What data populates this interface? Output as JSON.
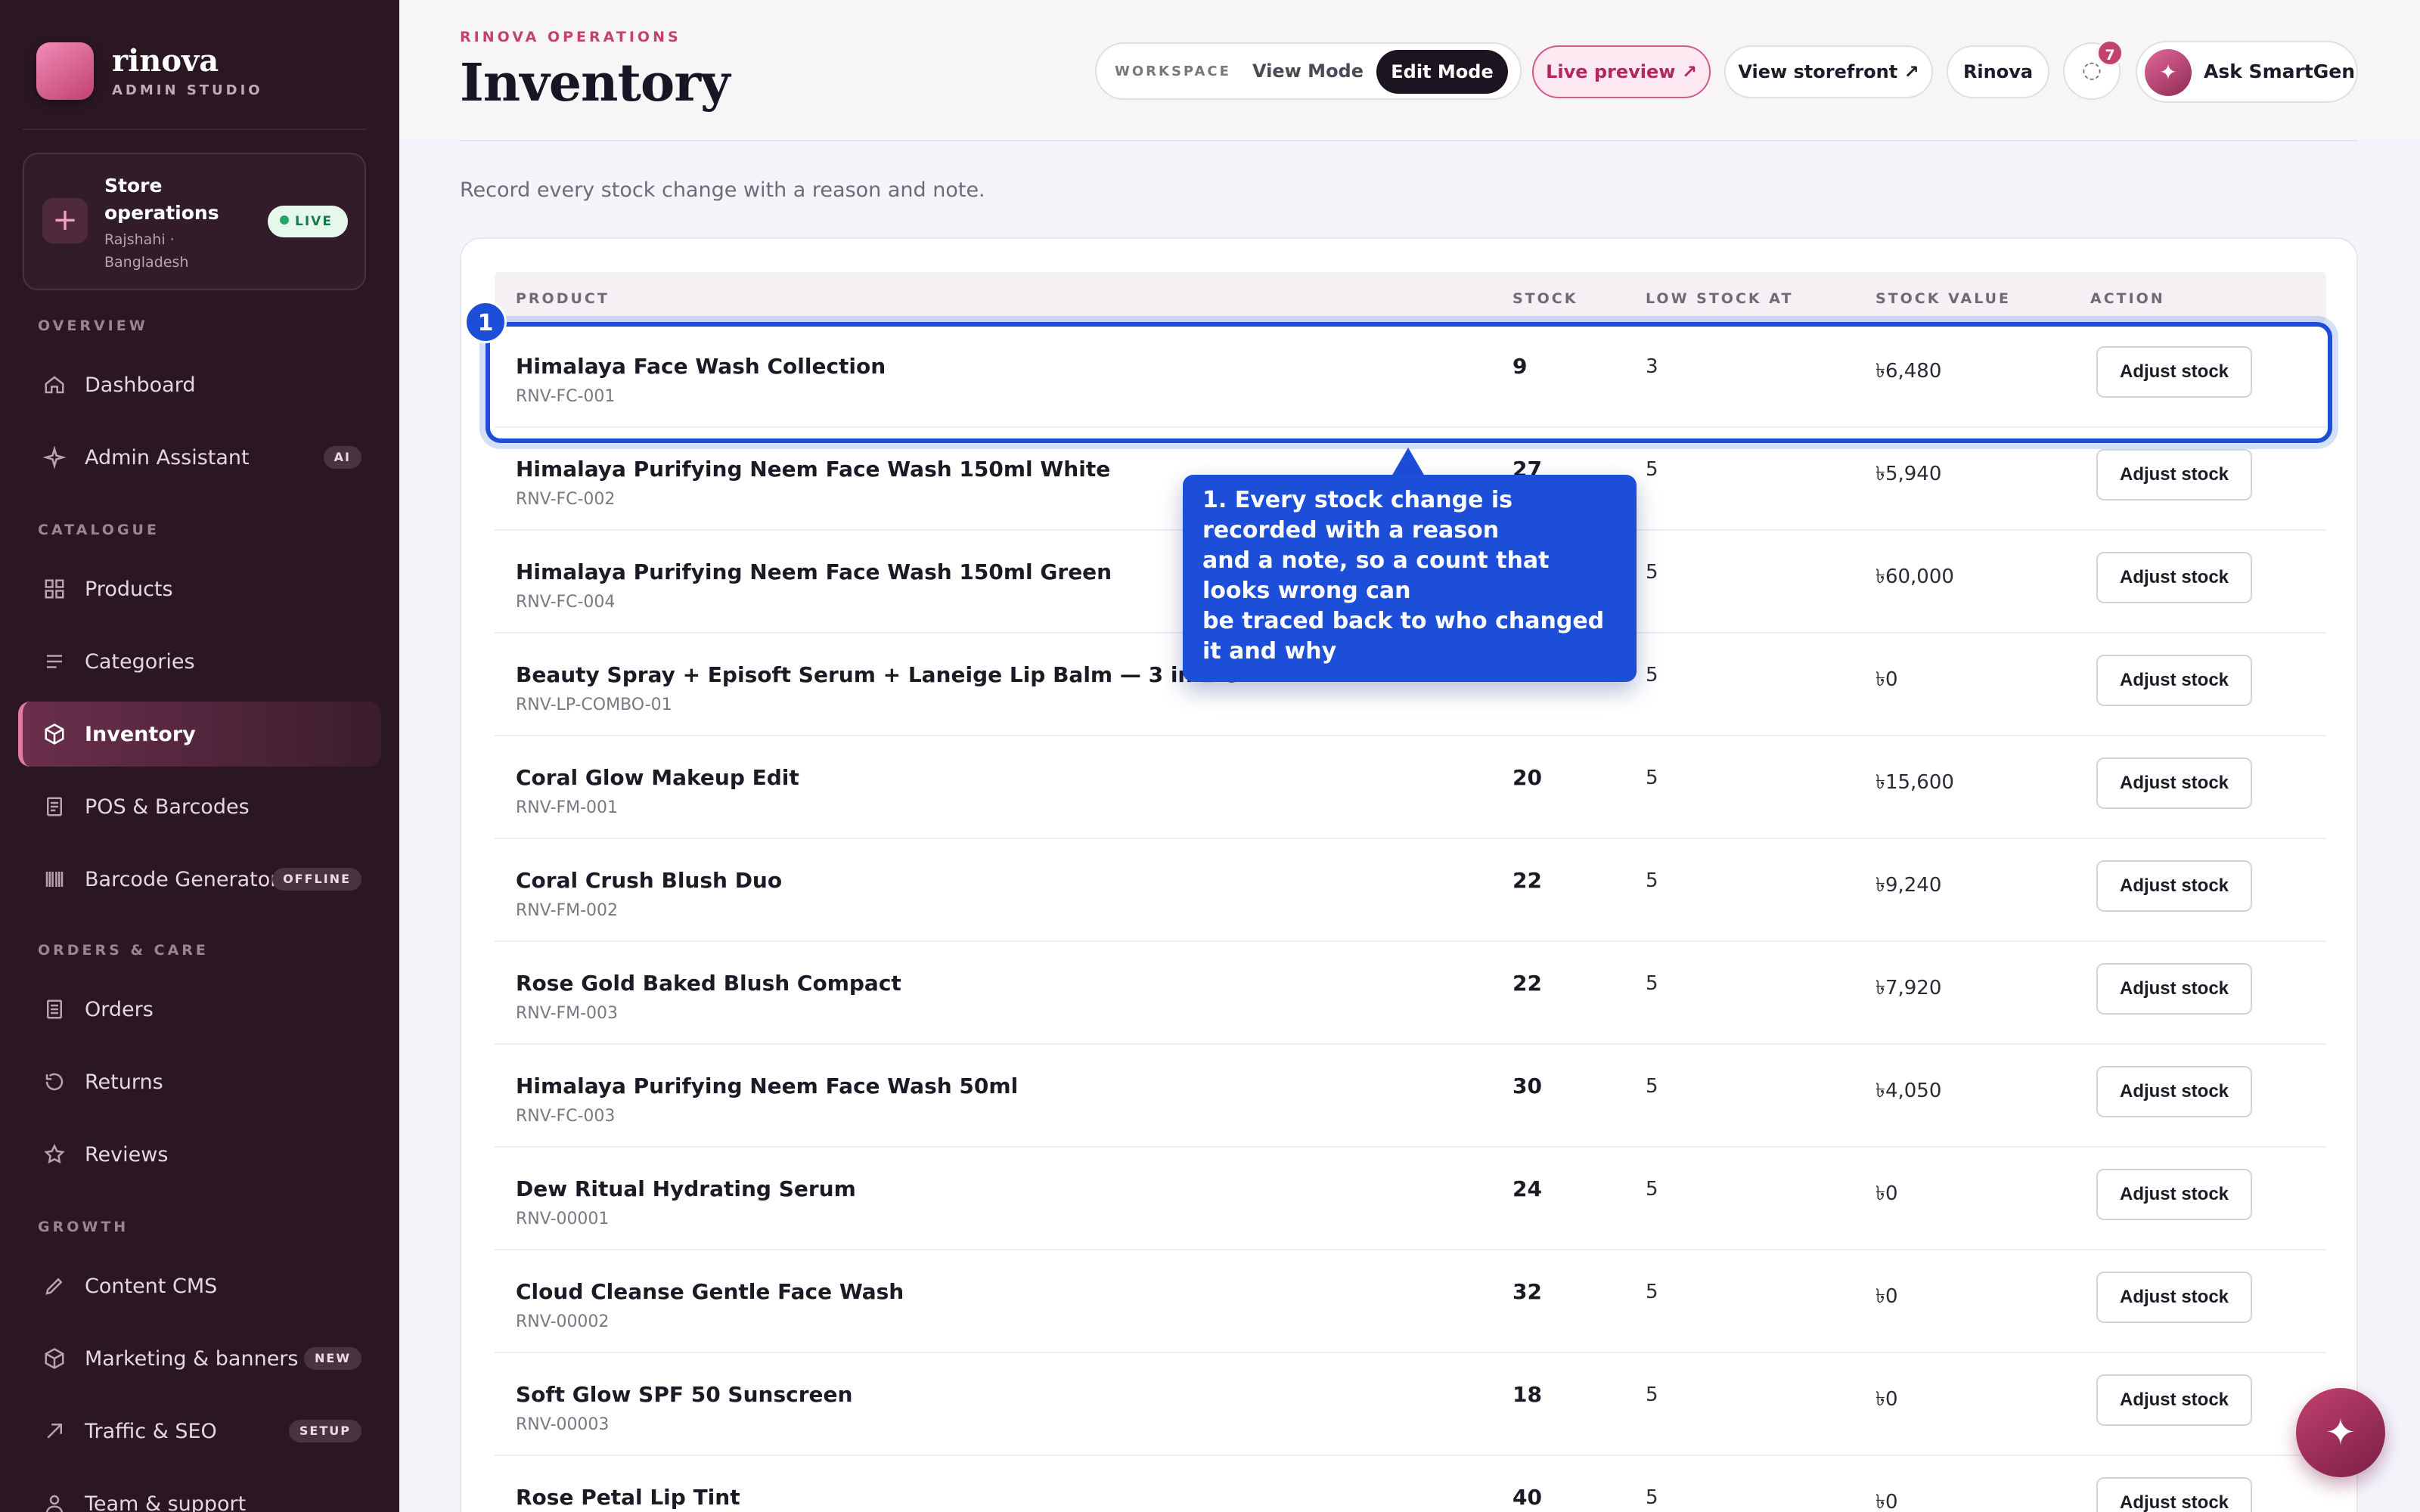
{
  "brand": {
    "name": "rinova",
    "subtitle": "ADMIN STUDIO"
  },
  "store": {
    "title": "Store operations",
    "location": "Rajshahi · Bangladesh",
    "status": "LIVE"
  },
  "nav": {
    "sections": {
      "overview": "OVERVIEW",
      "catalogue": "CATALOGUE",
      "orders": "ORDERS & CARE",
      "growth": "GROWTH"
    },
    "items": {
      "dashboard": "Dashboard",
      "assistant": "Admin Assistant",
      "assistant_tag": "AI",
      "products": "Products",
      "categories": "Categories",
      "inventory": "Inventory",
      "pos": "POS & Barcodes",
      "barcode": "Barcode Generator",
      "barcode_tag": "OFFLINE",
      "orders": "Orders",
      "returns": "Returns",
      "reviews": "Reviews",
      "cms": "Content CMS",
      "marketing": "Marketing & banners",
      "marketing_tag": "NEW",
      "traffic": "Traffic & SEO",
      "traffic_tag": "SETUP",
      "team": "Team & support"
    }
  },
  "header": {
    "eyebrow": "RINOVA OPERATIONS",
    "title": "Inventory",
    "mode": {
      "label": "WORKSPACE",
      "view": "View Mode",
      "edit": "Edit Mode"
    },
    "live_preview": "Live preview ↗",
    "storefront": "View storefront ↗",
    "store_name": "Rinova",
    "notifications": "7",
    "ask": "Ask SmartGen"
  },
  "subtitle": "Record every stock change with a reason and note.",
  "table": {
    "columns": {
      "product": "PRODUCT",
      "stock": "STOCK",
      "low": "LOW STOCK AT",
      "value": "STOCK VALUE",
      "action": "ACTION"
    },
    "action_label": "Adjust stock",
    "rows": [
      {
        "name": "Himalaya Face Wash Collection",
        "sku": "RNV-FC-001",
        "stock": "9",
        "low": "3",
        "value": "৳6,480"
      },
      {
        "name": "Himalaya Purifying Neem Face Wash 150ml White",
        "sku": "RNV-FC-002",
        "stock": "27",
        "low": "5",
        "value": "৳5,940"
      },
      {
        "name": "Himalaya Purifying Neem Face Wash 150ml Green",
        "sku": "RNV-FC-004",
        "stock": "",
        "low": "5",
        "value": "৳60,000"
      },
      {
        "name": "Beauty Spray + Episoft Serum + Laneige Lip Balm — 3 in 1 C",
        "sku": "RNV-LP-COMBO-01",
        "stock": "",
        "low": "5",
        "value": "৳0"
      },
      {
        "name": "Coral Glow Makeup Edit",
        "sku": "RNV-FM-001",
        "stock": "20",
        "low": "5",
        "value": "৳15,600"
      },
      {
        "name": "Coral Crush Blush Duo",
        "sku": "RNV-FM-002",
        "stock": "22",
        "low": "5",
        "value": "৳9,240"
      },
      {
        "name": "Rose Gold Baked Blush Compact",
        "sku": "RNV-FM-003",
        "stock": "22",
        "low": "5",
        "value": "৳7,920"
      },
      {
        "name": "Himalaya Purifying Neem Face Wash 50ml",
        "sku": "RNV-FC-003",
        "stock": "30",
        "low": "5",
        "value": "৳4,050"
      },
      {
        "name": "Dew Ritual Hydrating Serum",
        "sku": "RNV-00001",
        "stock": "24",
        "low": "5",
        "value": "৳0"
      },
      {
        "name": "Cloud Cleanse Gentle Face Wash",
        "sku": "RNV-00002",
        "stock": "32",
        "low": "5",
        "value": "৳0"
      },
      {
        "name": "Soft Glow SPF 50 Sunscreen",
        "sku": "RNV-00003",
        "stock": "18",
        "low": "5",
        "value": "৳0"
      },
      {
        "name": "Rose Petal Lip Tint",
        "sku": "",
        "stock": "40",
        "low": "5",
        "value": "৳0"
      }
    ]
  },
  "tour": {
    "step": "1",
    "lines": [
      "1. Every stock change is",
      "recorded with a reason",
      "and a note, so a count that",
      "looks wrong can",
      "be traced back to who changed",
      "it and why"
    ]
  },
  "fab": {
    "icon": "sparkle-icon"
  }
}
